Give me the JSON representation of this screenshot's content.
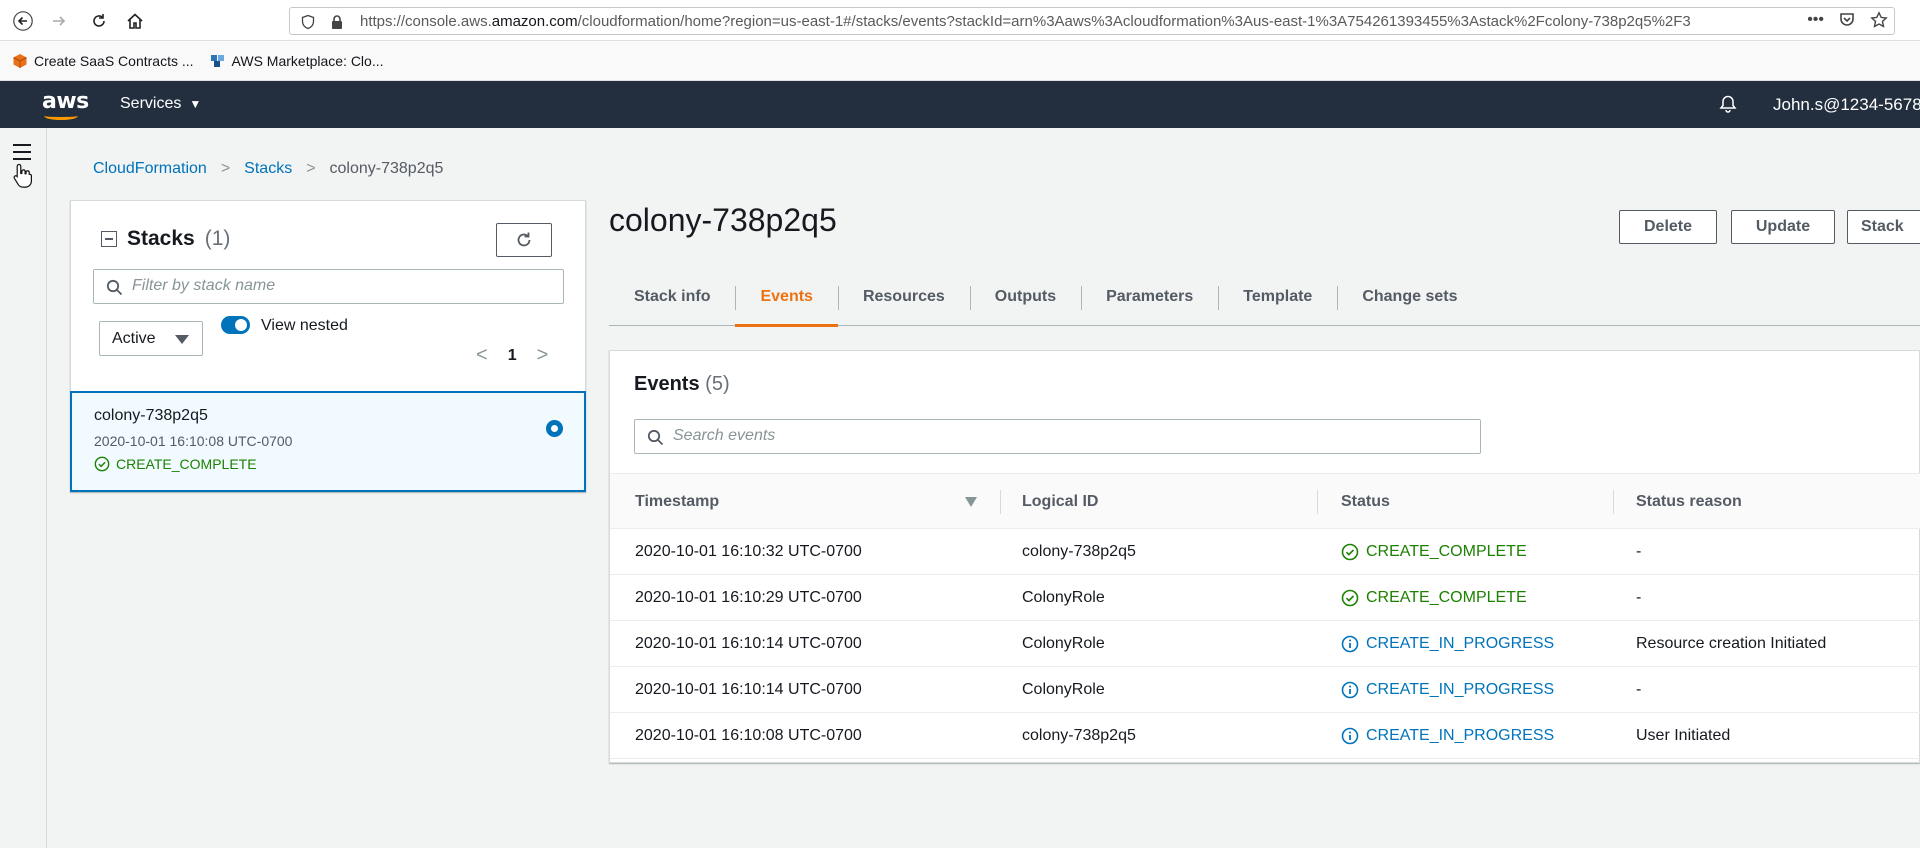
{
  "browser": {
    "url_prefix": "https://console.aws.",
    "url_domain": "amazon.com",
    "url_suffix": "/cloudformation/home?region=us-east-1#/stacks/events?stackId=arn%3Aaws%3Acloudformation%3Aus-east-1%3A754261393455%3Astack%2Fcolony-738p2q5%2F3",
    "bookmarks": [
      {
        "label": "Create SaaS Contracts ...",
        "icon": "package-icon"
      },
      {
        "label": "AWS Marketplace: Clo...",
        "icon": "aws-marketplace-icon"
      }
    ]
  },
  "header": {
    "logo": "aws",
    "services_label": "Services",
    "user": "John.s@1234-5678"
  },
  "breadcrumb": {
    "items": [
      "CloudFormation",
      "Stacks"
    ],
    "current": "colony-738p2q5"
  },
  "stacks_panel": {
    "title": "Stacks",
    "count": "(1)",
    "filter_placeholder": "Filter by stack name",
    "status_filter": "Active",
    "view_nested_label": "View nested",
    "page": "1",
    "stack": {
      "name": "colony-738p2q5",
      "date": "2020-10-01 16:10:08 UTC-0700",
      "status": "CREATE_COMPLETE"
    }
  },
  "main": {
    "title": "colony-738p2q5",
    "buttons": [
      "Delete",
      "Update",
      "Stack"
    ],
    "tabs": [
      "Stack info",
      "Events",
      "Resources",
      "Outputs",
      "Parameters",
      "Template",
      "Change sets"
    ],
    "active_tab": "Events"
  },
  "events": {
    "title": "Events",
    "count": "(5)",
    "search_placeholder": "Search events",
    "columns": [
      "Timestamp",
      "Logical ID",
      "Status",
      "Status reason"
    ],
    "rows": [
      {
        "timestamp": "2020-10-01 16:10:32 UTC-0700",
        "logical_id": "colony-738p2q5",
        "status": "CREATE_COMPLETE",
        "kind": "ok",
        "reason": "-"
      },
      {
        "timestamp": "2020-10-01 16:10:29 UTC-0700",
        "logical_id": "ColonyRole",
        "status": "CREATE_COMPLETE",
        "kind": "ok",
        "reason": "-"
      },
      {
        "timestamp": "2020-10-01 16:10:14 UTC-0700",
        "logical_id": "ColonyRole",
        "status": "CREATE_IN_PROGRESS",
        "kind": "prog",
        "reason": "Resource creation Initiated"
      },
      {
        "timestamp": "2020-10-01 16:10:14 UTC-0700",
        "logical_id": "ColonyRole",
        "status": "CREATE_IN_PROGRESS",
        "kind": "prog",
        "reason": "-"
      },
      {
        "timestamp": "2020-10-01 16:10:08 UTC-0700",
        "logical_id": "colony-738p2q5",
        "status": "CREATE_IN_PROGRESS",
        "kind": "prog",
        "reason": "User Initiated"
      }
    ]
  },
  "colors": {
    "success": "#1d8102",
    "info": "#0073bb",
    "accent": "#ec7211",
    "header_bg": "#232f3e"
  }
}
